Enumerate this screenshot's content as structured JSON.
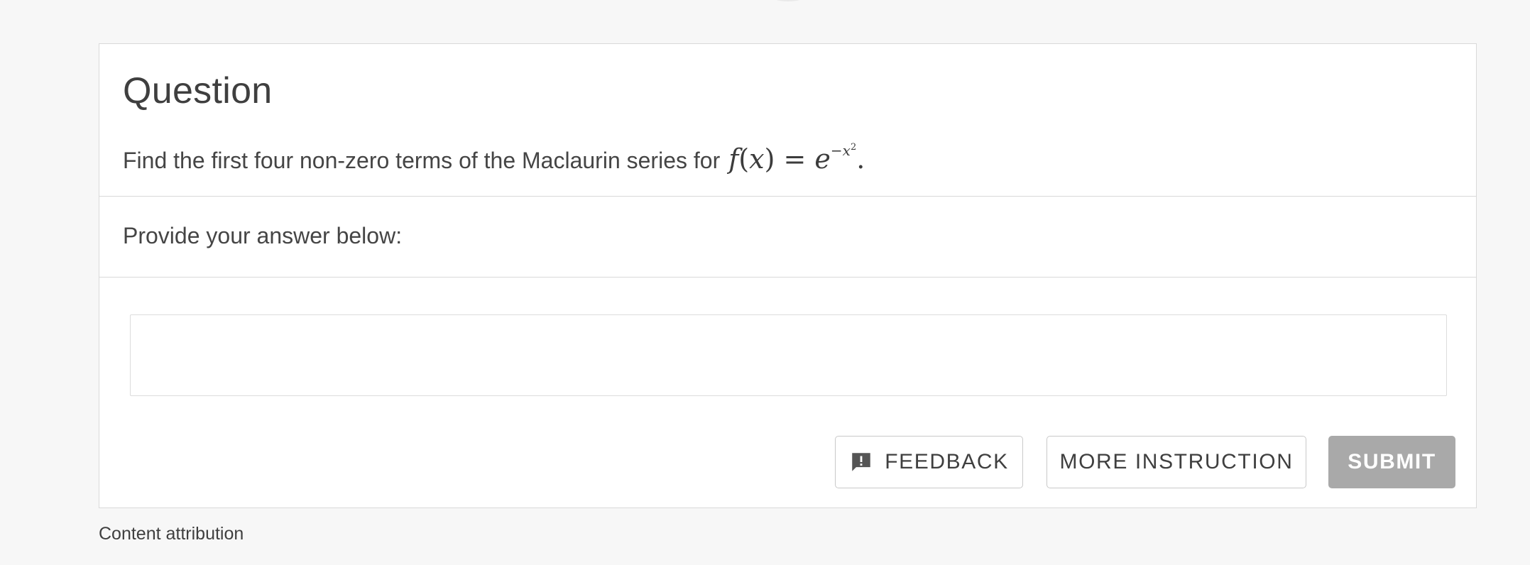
{
  "question": {
    "heading": "Question",
    "text": "Find the first four non-zero terms of the Maclaurin series for",
    "formula": {
      "function_name": "f",
      "variable": "x",
      "equals": "=",
      "base": "e",
      "exponent_sign": "−",
      "exponent_var": "x",
      "exponent_power": "2",
      "trailing": "."
    }
  },
  "answer": {
    "prompt": "Provide your answer below:",
    "input_value": "",
    "input_placeholder": ""
  },
  "buttons": {
    "feedback_label": "FEEDBACK",
    "feedback_icon": "feedback-icon",
    "more_instruction_label": "MORE INSTRUCTION",
    "submit_label": "SUBMIT"
  },
  "footer": {
    "attribution_label": "Content attribution"
  },
  "colors": {
    "page_background": "#f7f7f7",
    "card_background": "#ffffff",
    "border": "#d9d9d9",
    "submit_disabled": "#a9a9a9",
    "text": "#454545"
  }
}
